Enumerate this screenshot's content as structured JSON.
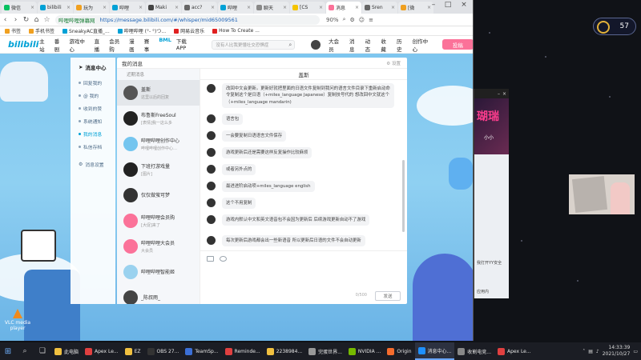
{
  "browser": {
    "tabs": [
      {
        "label": "微信",
        "color": "#07c160"
      },
      {
        "label": "bilibili",
        "color": "#00a1d6"
      },
      {
        "label": "玩为",
        "color": "#f0a020"
      },
      {
        "label": "哔哩",
        "color": "#00a1d6"
      },
      {
        "label": "Maki",
        "color": "#444"
      },
      {
        "label": "acc?",
        "color": "#666"
      },
      {
        "label": "哔哩",
        "color": "#00a1d6"
      },
      {
        "label": "聊天",
        "color": "#888"
      },
      {
        "label": "[CS",
        "color": "#f5c400"
      },
      {
        "label": "消息",
        "color": "#fb7299"
      },
      {
        "label": "Sren",
        "color": "#666"
      },
      {
        "label": "[微",
        "color": "#f0a020"
      }
    ],
    "url_site": "哔哩哔哩弹幕网",
    "url": "https://message.bilibili.com/#/whisper/mid65009561",
    "zoom": "90%",
    "bookmarks": [
      {
        "label": "书签",
        "color": "#f0a020"
      },
      {
        "label": "手机书签",
        "color": "#f0a020"
      },
      {
        "label": "SneakyAC直播_...",
        "color": "#00a1d6"
      },
      {
        "label": "哔哩哔哩 (°- °)つ...",
        "color": "#00a1d6"
      },
      {
        "label": "网易云音乐",
        "color": "#e02020"
      },
      {
        "label": "How To Create ...",
        "color": "#e02020"
      }
    ]
  },
  "bili_header": {
    "logo": "bilibili",
    "nav": [
      "主站",
      "番剧",
      "游戏中心",
      "直播",
      "会员购",
      "漫画",
      "赛事",
      "BML",
      "下载APP"
    ],
    "search_placeholder": "没有人比我更懂社交恐惧症",
    "right_nav": [
      "大会员",
      "消息",
      "动态",
      "收藏",
      "历史",
      "创作中心"
    ],
    "upload": "投稿"
  },
  "msg_sidebar": {
    "title": "消息中心",
    "items": [
      "回复我的",
      "@ 我的",
      "收到的赞",
      "系统通知",
      "我的消息",
      "私信存档",
      "消息设置"
    ]
  },
  "msg_main": {
    "title": "我的消息",
    "settings": "设置",
    "list_header": "近期消息",
    "conversations": [
      {
        "name": "盖斯",
        "preview": "这里以后的回复",
        "color": "#555"
      },
      {
        "name": "布鲁斯FreeSoul",
        "preview": "[表情]我一这么多",
        "color": "#222"
      },
      {
        "name": "哔哩哔哩创作中心",
        "preview": "哔哩哔哩创作中心…",
        "color": "#74c5ef"
      },
      {
        "name": "下班打游戏量",
        "preview": "[图片]",
        "color": "#222"
      },
      {
        "name": "仅仅做萤可梦",
        "preview": "",
        "color": "#333"
      },
      {
        "name": "哔哩哔哩会员购",
        "preview": "[大促]来了",
        "color": "#fb7299"
      },
      {
        "name": "哔哩哔哩大会员",
        "preview": "大会员",
        "color": "#fb7299"
      },
      {
        "name": "哔哩哔哩智能姬",
        "preview": "",
        "color": "#9ad2ef"
      },
      {
        "name": "_陈叔雨_",
        "preview": "",
        "color": "#444"
      }
    ],
    "chat_title": "盖斯",
    "messages": [
      "改回中文会更新。更新好就把里面的日语文件复制到我问的语言文件目录下重新启动命令复制这个是日语（+miles_language Japanese）复制技号代的 想改回中文就这个（+miles_language mandarin)",
      "语言包",
      "一会要复制日语语言文件保存",
      "游戏更新后还是需要这样反复操作比较麻烦",
      "或者另外点的",
      "最进进阶启动项+miles_language english",
      "这个不用复制",
      "游戏内默认中文和英文语音包不会因为更新后 后续游戏更新自动不了游戏",
      "每次更新后游戏都会出一些新语音 所以更新后日语的文件不会自动更新"
    ],
    "char_count": "0/500",
    "send": "发送"
  },
  "overlay_number": "57",
  "side_app": {
    "banner_text": "瑚瑞",
    "banner_sub": "小小",
    "text1": "我打开YY安全",
    "text2": "应用内"
  },
  "desktop": {
    "vlc": "VLC media player"
  },
  "taskbar": {
    "apps": [
      {
        "label": "此电脑",
        "color": "#f0c040"
      },
      {
        "label": "Apex Le...",
        "color": "#e04040"
      },
      {
        "label": "EZ",
        "color": "#f0c040"
      },
      {
        "label": "OBS 27...",
        "color": "#333"
      },
      {
        "label": "TeamSp...",
        "color": "#3b6fd6"
      },
      {
        "label": "Reminde...",
        "color": "#e04040"
      },
      {
        "label": "2238984...",
        "color": "#f0c040"
      },
      {
        "label": "完蛋世界...",
        "color": "#999"
      },
      {
        "label": "NVIDIA ...",
        "color": "#76b900"
      },
      {
        "label": "Origin",
        "color": "#f56c2d"
      },
      {
        "label": "消息中心...",
        "color": "#1e90ff"
      },
      {
        "label": "收割电竞...",
        "color": "#888"
      },
      {
        "label": "Apex Le...",
        "color": "#e04040"
      }
    ],
    "time": "14:33:39",
    "date": "2021/10/27"
  }
}
